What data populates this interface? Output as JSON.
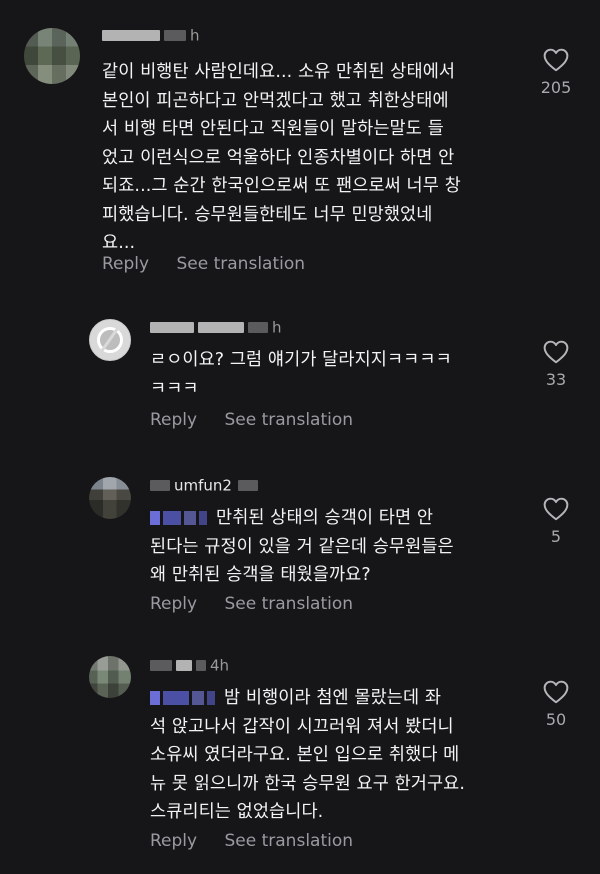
{
  "comments": [
    {
      "username_visible": "h",
      "lines": [
        "같이 비행탄 사람인데요... 소유 만취된 상태에서",
        "본인이 피곤하다고 안먹겠다고 했고 취한상태에",
        "서 비행 타면 안된다고 직원들이 말하는말도 들",
        "었고 이런식으로 억울하다 인종차별이다 하면 안",
        "되죠...그 순간 한국인으로써 또 팬으로써 너무 창",
        "피했습니다. 승무원들한테도 너무 민망했었네",
        "요..."
      ],
      "like_count": "205",
      "reply_label": "Reply",
      "translate_label": "See translation"
    },
    {
      "username_visible": "h",
      "lines": [
        "ㄹㅇ이요? 그럼 얘기가 달라지지ㅋㅋㅋㅋ",
        "ㅋㅋㅋ"
      ],
      "like_count": "33",
      "reply_label": "Reply",
      "translate_label": "See translation"
    },
    {
      "username_visible": "umfun2",
      "lines": [
        "만취된 상태의 승객이 타면 안",
        "된다는 규정이 있을 거 같은데 승무원들은",
        "왜 만취된 승객을 태웠을까요?"
      ],
      "like_count": "5",
      "reply_label": "Reply",
      "translate_label": "See translation"
    },
    {
      "username_visible": "4h",
      "lines": [
        "밤 비행이라 첨엔 몰랐는데 좌",
        "석 앉고나서 갑작이 시끄러워 져서 봤더니",
        "소유씨 였더라구요. 본인 입으로 취했다 메",
        "뉴 못 읽으니까 한국 승무원 요구 한거구요.",
        "스큐리티는 없었습니다."
      ],
      "like_count": "50",
      "reply_label": "Reply",
      "translate_label": "See translation"
    }
  ],
  "colors": {
    "background": "#161619",
    "text": "#f3f3f3",
    "muted": "#9a9aa0",
    "mention": "#6a6ed6"
  },
  "icons": {
    "like": "heart-outline-icon"
  }
}
